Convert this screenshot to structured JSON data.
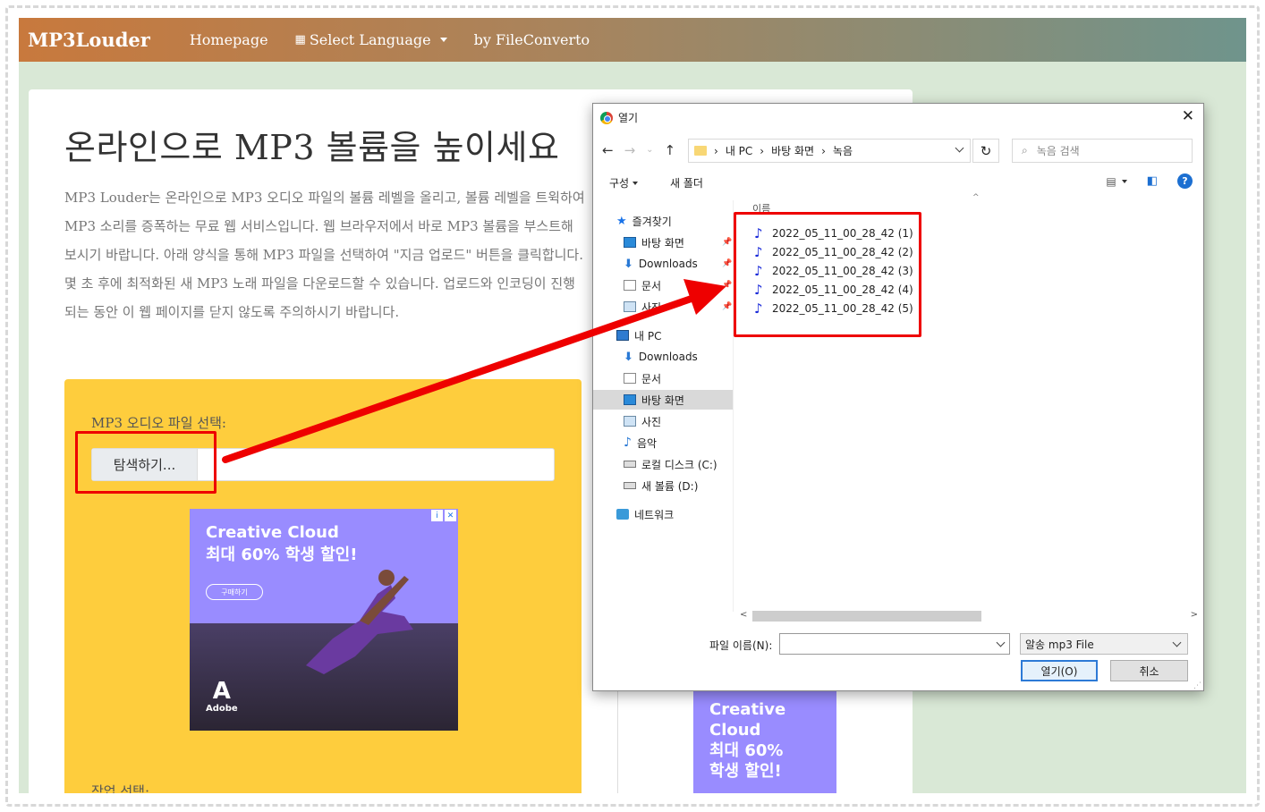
{
  "navbar": {
    "brand": "MP3Louder",
    "links": [
      "Homepage",
      "Select Language",
      "by FileConverto"
    ]
  },
  "main": {
    "title": "온라인으로 MP3 볼륨을 높이세요",
    "description": "MP3 Louder는 온라인으로 MP3 오디오 파일의 볼륨 레벨을 올리고, 볼륨 레벨을 트윅하여 MP3 소리를 증폭하는 무료 웹 서비스입니다. 웹 브라우저에서 바로 MP3 볼륨을 부스트해 보시기 바랍니다. 아래 양식을 통해 MP3 파일을 선택하여 \"지금 업로드\" 버튼을 클릭합니다. 몇 초 후에 최적화된 새 MP3 노래 파일을 다운로드할 수 있습니다. 업로드와 인코딩이 진행되는 동안 이 웹 페이지를 닫지 않도록 주의하시기 바랍니다.",
    "upload": {
      "label": "MP3 오디오 파일 선택:",
      "browse_button": "탐색하기...",
      "task_label": "작업 선택:"
    },
    "ad": {
      "title_line1": "Creative Cloud",
      "title_line2": "최대 60% 학생 할인!",
      "button": "구매하기",
      "logo": "Adobe"
    },
    "side_ad": {
      "line1": "Creative Cloud",
      "line2": "최대 60%",
      "line3": "학생 할인!"
    }
  },
  "dialog": {
    "title": "열기",
    "breadcrumb": [
      "내 PC",
      "바탕 화면",
      "녹음"
    ],
    "search_placeholder": "녹음 검색",
    "toolbar": {
      "organize": "구성",
      "new_folder": "새 폴더"
    },
    "column_header": "이름",
    "tree": {
      "quick_access": "즐겨찾기",
      "quick_items": [
        "바탕 화면",
        "Downloads",
        "문서",
        "사진"
      ],
      "this_pc": "내 PC",
      "pc_items": [
        "Downloads",
        "문서",
        "바탕 화면",
        "사진",
        "음악",
        "로컬 디스크 (C:)",
        "새 볼륨 (D:)"
      ],
      "network": "네트워크"
    },
    "files": [
      "2022_05_11_00_28_42 (1)",
      "2022_05_11_00_28_42 (2)",
      "2022_05_11_00_28_42 (3)",
      "2022_05_11_00_28_42 (4)",
      "2022_05_11_00_28_42 (5)"
    ],
    "filename_label": "파일 이름(N):",
    "filename_value": "",
    "filetype": "알송 mp3 File",
    "open_button": "열기(O)",
    "cancel_button": "취소"
  },
  "colors": {
    "annotation": "#ee0000",
    "upload_bg": "#fecd3d",
    "page_bg": "#d9e8d6"
  }
}
